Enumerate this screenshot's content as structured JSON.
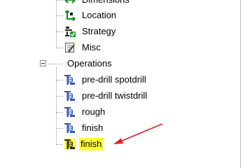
{
  "tree": {
    "setup_children": [
      {
        "label": "Dimensions",
        "icon": "dimensions-icon"
      },
      {
        "label": "Location",
        "icon": "location-icon"
      },
      {
        "label": "Strategy",
        "icon": "strategy-icon"
      },
      {
        "label": "Misc",
        "icon": "misc-icon"
      }
    ],
    "operations": {
      "label": "Operations",
      "expanded": true,
      "items": [
        {
          "label": "pre-drill spotdrill",
          "icon": "drill-operation-icon"
        },
        {
          "label": "pre-drill twistdrill",
          "icon": "drill-operation-icon"
        },
        {
          "label": "rough",
          "icon": "drill-operation-icon"
        },
        {
          "label": "finish",
          "icon": "drill-operation-icon"
        },
        {
          "label": "finish",
          "icon": "drill-operation-icon",
          "selected": true,
          "highlight_color": "#ffff33"
        }
      ]
    }
  },
  "annotation": {
    "arrow_color": "#e02020"
  }
}
